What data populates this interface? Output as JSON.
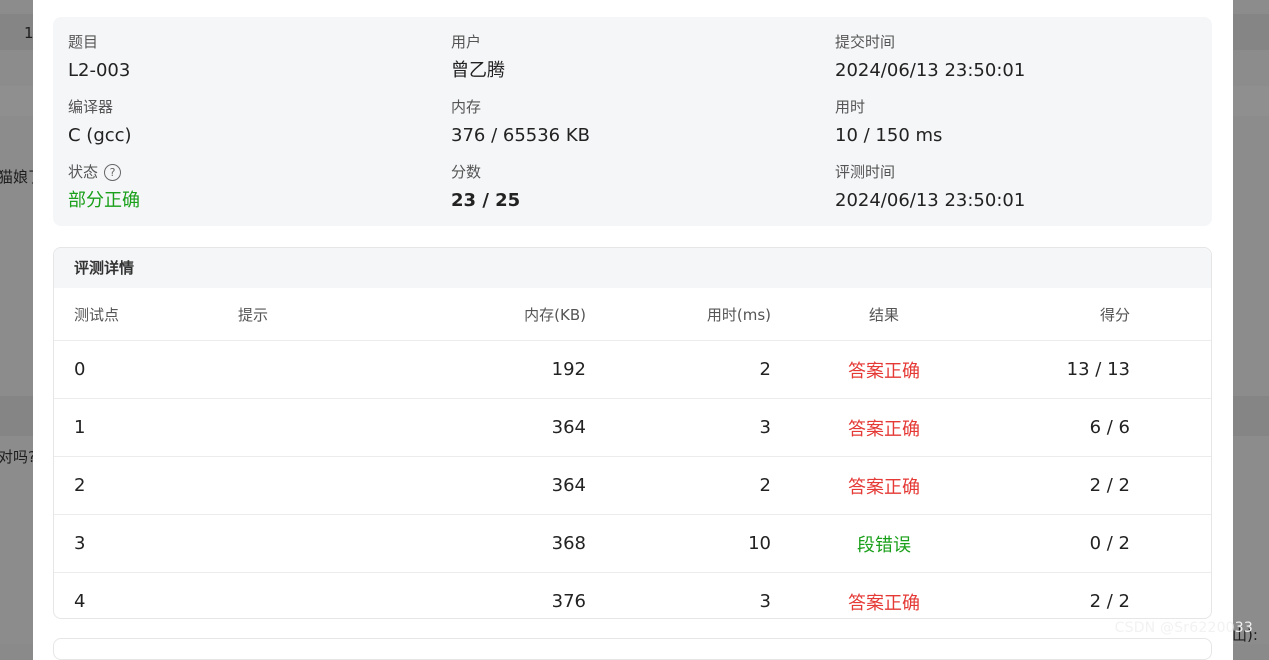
{
  "background": {
    "fragments": [
      "1",
      "猫娘了",
      "对吗?",
      "山):"
    ]
  },
  "summary": {
    "problem": {
      "label": "题目",
      "value": "L2-003"
    },
    "user": {
      "label": "用户",
      "value": "曾乙腾"
    },
    "submit_time": {
      "label": "提交时间",
      "value": "2024/06/13 23:50:01"
    },
    "compiler": {
      "label": "编译器",
      "value": "C (gcc)"
    },
    "memory": {
      "label": "内存",
      "value": "376 / 65536 KB"
    },
    "time_used": {
      "label": "用时",
      "value": "10 / 150 ms"
    },
    "status": {
      "label": "状态",
      "value": "部分正确",
      "icon": "question-circle-icon"
    },
    "score": {
      "label": "分数",
      "value": "23 / 25"
    },
    "judge_time": {
      "label": "评测时间",
      "value": "2024/06/13 23:50:01"
    }
  },
  "detail": {
    "title": "评测详情",
    "columns": [
      "测试点",
      "提示",
      "内存(KB)",
      "用时(ms)",
      "结果",
      "得分"
    ],
    "rows": [
      {
        "id": "0",
        "hint": "",
        "memory": "192",
        "time": "2",
        "result": "答案正确",
        "score": "13 / 13"
      },
      {
        "id": "1",
        "hint": "",
        "memory": "364",
        "time": "3",
        "result": "答案正确",
        "score": "6 / 6"
      },
      {
        "id": "2",
        "hint": "",
        "memory": "364",
        "time": "2",
        "result": "答案正确",
        "score": "2 / 2"
      },
      {
        "id": "3",
        "hint": "",
        "memory": "368",
        "time": "10",
        "result": "段错误",
        "score": "0 / 2"
      },
      {
        "id": "4",
        "hint": "",
        "memory": "376",
        "time": "3",
        "result": "答案正确",
        "score": "2 / 2"
      }
    ]
  },
  "colors": {
    "accepted": "#e53935",
    "partial": "#1aa01a",
    "error": "#1aa01a"
  },
  "watermark": "CSDN @Sr6220033"
}
